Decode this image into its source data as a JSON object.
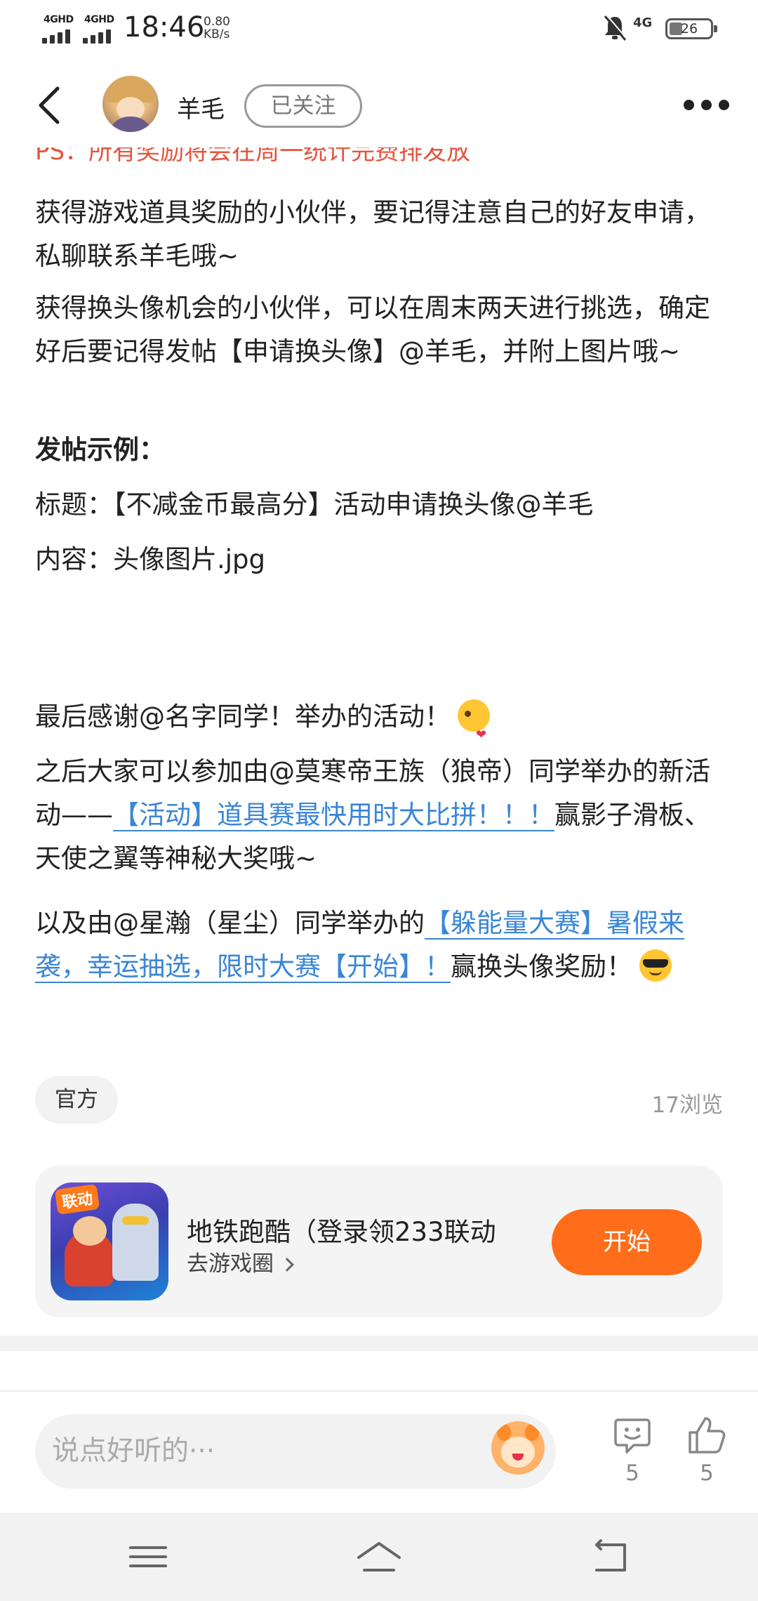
{
  "status_bar": {
    "sim1": "4GHD",
    "sim2": "4GHD",
    "time": "18:46",
    "speed_value": "0.80",
    "speed_unit": "KB/s",
    "network": "4G",
    "battery": "26"
  },
  "header": {
    "username": "羊毛",
    "follow_label": "已关注"
  },
  "post": {
    "cut_line": "PS：所有奖励将会在周一统计完费排发放",
    "paragraphs": [
      "获得游戏道具奖励的小伙伴，要记得注意自己的好友申请，私聊联系羊毛哦~",
      "获得换头像机会的小伙伴，可以在周末两天进行挑选，确定好后要记得发帖【申请换头像】@羊毛，并附上图片哦~",
      "发帖示例：",
      "标题：【不减金币最高分】活动申请换头像@羊毛",
      "内容：头像图片.jpg"
    ],
    "thanks": "最后感谢@名字同学！举办的活动！",
    "next_prefix": "之后大家可以参加由@莫寒帝王族（狼帝）同学举办的新活动——",
    "next_link": "【活动】道具赛最快用时大比拼！！！",
    "next_suffix": "赢影子滑板、天使之翼等神秘大奖哦~",
    "also_prefix": "以及由@星瀚（星尘）同学举办的",
    "also_link": "【躲能量大赛】暑假来袭，幸运抽选，限时大赛【开始】！",
    "also_suffix": "赢换头像奖励！"
  },
  "meta": {
    "tag": "官方",
    "views": "17浏览"
  },
  "game_card": {
    "badge": "联动",
    "title": "地铁跑酷（登录领233联动",
    "link_label": "去游戏圈",
    "start_label": "开始"
  },
  "comment_bar": {
    "placeholder": "说点好听的···",
    "comment_count": "5",
    "like_count": "5"
  },
  "icons": [
    "back-arrow-icon",
    "more-icon",
    "dnd-bell-icon",
    "comment-icon",
    "like-icon",
    "menu-icon",
    "home-icon",
    "return-icon"
  ],
  "colors": {
    "accent_orange": "#ff6d1a",
    "link_blue": "#3a86d6",
    "red_text": "#e7533b"
  }
}
